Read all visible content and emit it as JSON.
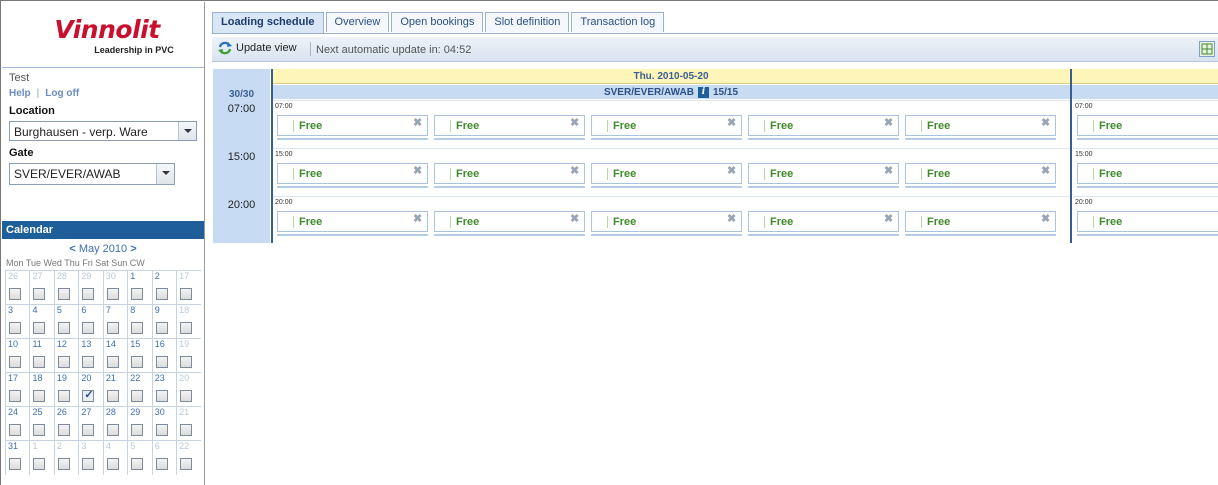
{
  "brand": {
    "name": "Vinnolit",
    "tagline": "Leadership in PVC"
  },
  "user": {
    "name": "Test",
    "help": "Help",
    "separator": "|",
    "logoff": "Log off"
  },
  "location": {
    "label": "Location",
    "value": "Burghausen - verp. Ware"
  },
  "gate": {
    "label": "Gate",
    "value": "SVER/EVER/AWAB"
  },
  "calendar": {
    "title": "Calendar",
    "month": "May 2010",
    "prev": "<",
    "next": ">",
    "day_headers": "Mon Tue Wed Thu Fri  Sat  Sun  CW",
    "weeks": [
      {
        "days": [
          "26",
          "27",
          "28",
          "29",
          "30",
          "1",
          "2"
        ],
        "cw": "17",
        "dim": [
          true,
          true,
          true,
          true,
          true,
          false,
          false
        ]
      },
      {
        "days": [
          "3",
          "4",
          "5",
          "6",
          "7",
          "8",
          "9"
        ],
        "cw": "18",
        "dim": [
          false,
          false,
          false,
          false,
          false,
          false,
          false
        ]
      },
      {
        "days": [
          "10",
          "11",
          "12",
          "13",
          "14",
          "15",
          "16"
        ],
        "cw": "19",
        "dim": [
          false,
          false,
          false,
          false,
          false,
          false,
          false
        ]
      },
      {
        "days": [
          "17",
          "18",
          "19",
          "20",
          "21",
          "22",
          "23"
        ],
        "cw": "20",
        "dim": [
          false,
          false,
          false,
          false,
          false,
          false,
          false
        ]
      },
      {
        "days": [
          "24",
          "25",
          "26",
          "27",
          "28",
          "29",
          "30"
        ],
        "cw": "21",
        "dim": [
          false,
          false,
          false,
          false,
          false,
          false,
          false
        ]
      },
      {
        "days": [
          "31",
          "1",
          "2",
          "3",
          "4",
          "5",
          "6"
        ],
        "cw": "22",
        "dim": [
          false,
          true,
          true,
          true,
          true,
          true,
          true
        ]
      }
    ],
    "checked": {
      "week": 3,
      "day": 3
    }
  },
  "tabs": [
    "Loading schedule",
    "Overview",
    "Open bookings",
    "Slot definition",
    "Transaction log"
  ],
  "active_tab": 0,
  "toolbar": {
    "update_label": "Update view",
    "next_update": "Next automatic update in: 04:52"
  },
  "schedule": {
    "count": "30/30",
    "day_title": "Thu. 2010-05-20",
    "gate_title": "SVER/EVER/AWAB",
    "gate_info_icon": "i",
    "gate_count": "15/15",
    "rows": [
      {
        "time": "07:00",
        "minitime": "07:00"
      },
      {
        "time": "15:00",
        "minitime": "15:00"
      },
      {
        "time": "20:00",
        "minitime": "20:00"
      }
    ],
    "slot_label": "Free",
    "slots_per_row": 5
  },
  "icons": [
    "refresh-icon",
    "grid-toggle-icon",
    "info-icon",
    "remove-icon",
    "dropdown-arrow-icon"
  ]
}
